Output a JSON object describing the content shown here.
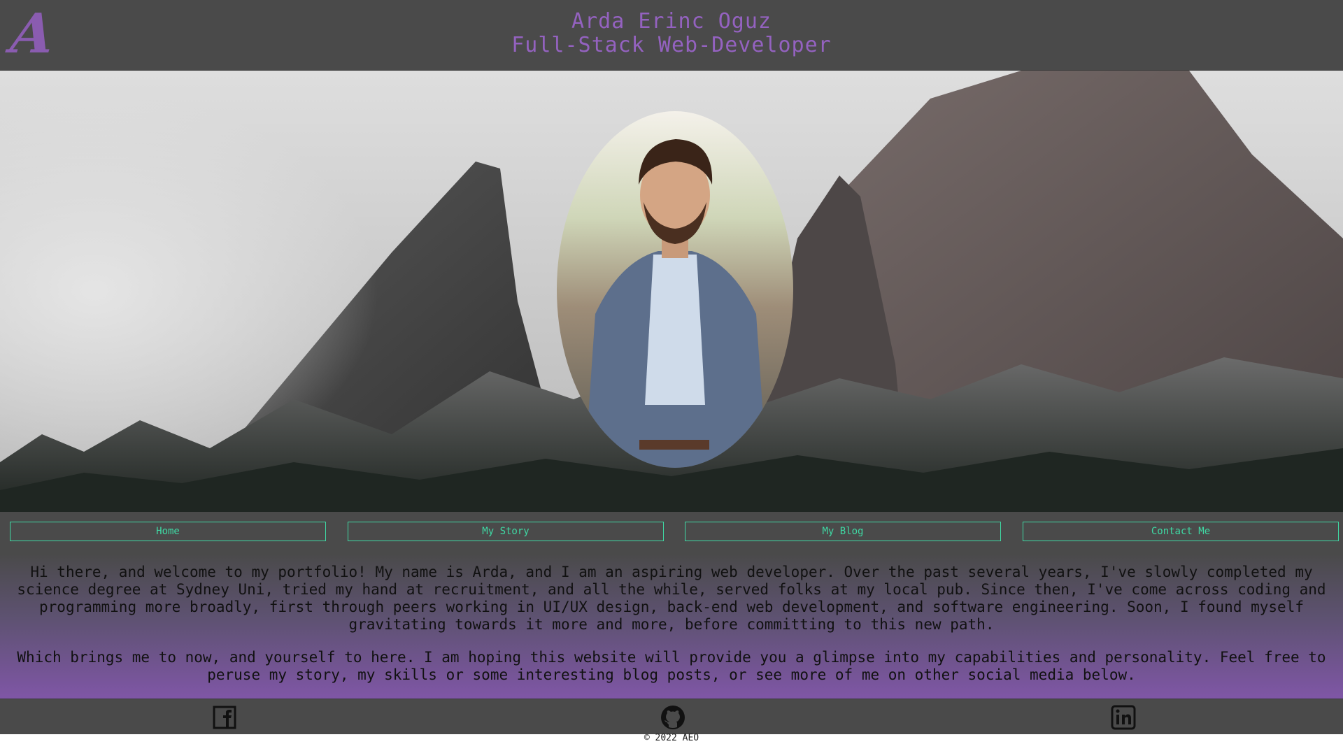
{
  "header": {
    "logo_letter": "A",
    "name": "Arda Erinc Oguz",
    "role": "Full-Stack Web-Developer"
  },
  "hero": {
    "background_image": "mountain-landscape",
    "portrait_image": "profile-photo"
  },
  "nav": {
    "items": [
      {
        "label": "Home"
      },
      {
        "label": "My Story"
      },
      {
        "label": "My Blog"
      },
      {
        "label": "Contact Me"
      }
    ]
  },
  "intro": {
    "paragraphs": [
      "Hi there, and welcome to my portfolio! My name is Arda, and I am an aspiring web developer. Over the past several years, I've slowly completed my science degree at Sydney Uni, tried my hand at recruitment, and all the while, served folks at my local pub. Since then, I've come across coding and programming more broadly, first through peers working in UI/UX design, back-end web development, and software engineering. Soon, I found myself gravitating towards it more and more, before committing to this new path.",
      "Which brings me to now, and yourself to here. I am hoping this website will provide you a glimpse into my capabilities and personality. Feel free to peruse my story, my skills or some interesting blog posts, or see more of me on other social media below."
    ]
  },
  "social": {
    "icons": [
      "facebook-icon",
      "github-icon",
      "linkedin-icon"
    ]
  },
  "footer": {
    "copyright": "© 2022 AEO"
  },
  "colors": {
    "header_bg": "#4a4a4a",
    "title_purple": "#9462c0",
    "nav_accent": "#3fd9a4",
    "gradient_purple": "#7f56a6"
  }
}
